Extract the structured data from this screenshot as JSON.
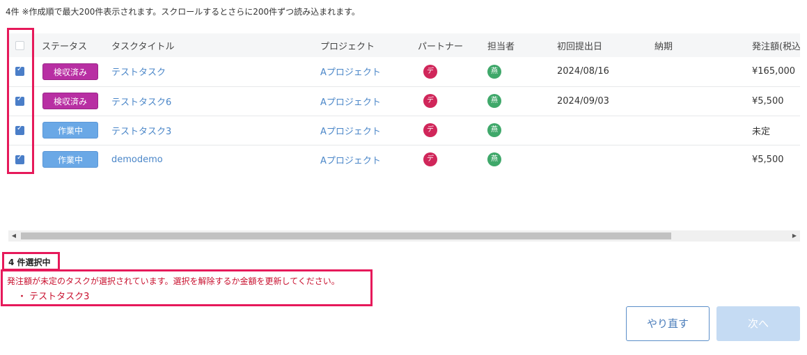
{
  "info_text": "4件 ※作成順で最大200件表示されます。スクロールするとさらに200件ずつ読み込まれます。",
  "table": {
    "headers": [
      "",
      "ステータス",
      "タスクタイトル",
      "プロジェクト",
      "パートナー",
      "担当者",
      "初回提出日",
      "納期",
      "発注額(税込"
    ],
    "rows": [
      {
        "checked": true,
        "status": "検収済み",
        "status_type": "inspected",
        "title": "テストタスク",
        "project": "Aプロジェクト",
        "partner": "デ",
        "assignee": "燕",
        "first_submission": "2024/08/16",
        "due": "",
        "amount": "¥165,000"
      },
      {
        "checked": true,
        "status": "検収済み",
        "status_type": "inspected",
        "title": "テストタスク6",
        "project": "Aプロジェクト",
        "partner": "デ",
        "assignee": "燕",
        "first_submission": "2024/09/03",
        "due": "",
        "amount": "¥5,500"
      },
      {
        "checked": true,
        "status": "作業中",
        "status_type": "working",
        "title": "テストタスク3",
        "project": "Aプロジェクト",
        "partner": "デ",
        "assignee": "燕",
        "first_submission": "",
        "due": "",
        "amount": "未定"
      },
      {
        "checked": true,
        "status": "作業中",
        "status_type": "working",
        "title": "demodemo",
        "project": "Aプロジェクト",
        "partner": "デ",
        "assignee": "燕",
        "first_submission": "",
        "due": "",
        "amount": "¥5,500"
      }
    ]
  },
  "selection": {
    "count_label": "4 件選択中"
  },
  "error": {
    "message": "発注額が未定のタスクが選択されています。選択を解除するか金額を更新してください。",
    "items": [
      "・ テストタスク3"
    ]
  },
  "buttons": {
    "redo": "やり直す",
    "next": "次へ"
  },
  "colors": {
    "inspected": "#b82fa3",
    "working": "#6aa8e6",
    "link": "#4a86c8",
    "highlight": "#e6195a",
    "error": "#c8102e"
  },
  "icons": {
    "scroll_left": "triangle-left-icon",
    "scroll_right": "triangle-right-icon"
  }
}
